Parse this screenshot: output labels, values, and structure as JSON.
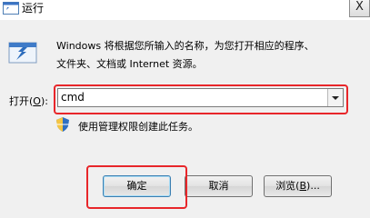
{
  "window": {
    "title": "运行",
    "close_label": "X"
  },
  "description": {
    "line1": "Windows 将根据您所输入的名称，为您打开相应的程序、",
    "line2": "文件夹、文档或 Internet 资源。"
  },
  "open": {
    "label": "打开",
    "accel": "O",
    "label_suffix": "):",
    "value": "cmd"
  },
  "admin_note": "使用管理权限创建此任务。",
  "buttons": {
    "ok": "确定",
    "cancel": "取消",
    "browse_prefix": "浏览(",
    "browse_accel": "B",
    "browse_suffix": ")..."
  },
  "colors": {
    "highlight": "#e8262a",
    "dialog_bg": "#f0f0f0"
  }
}
